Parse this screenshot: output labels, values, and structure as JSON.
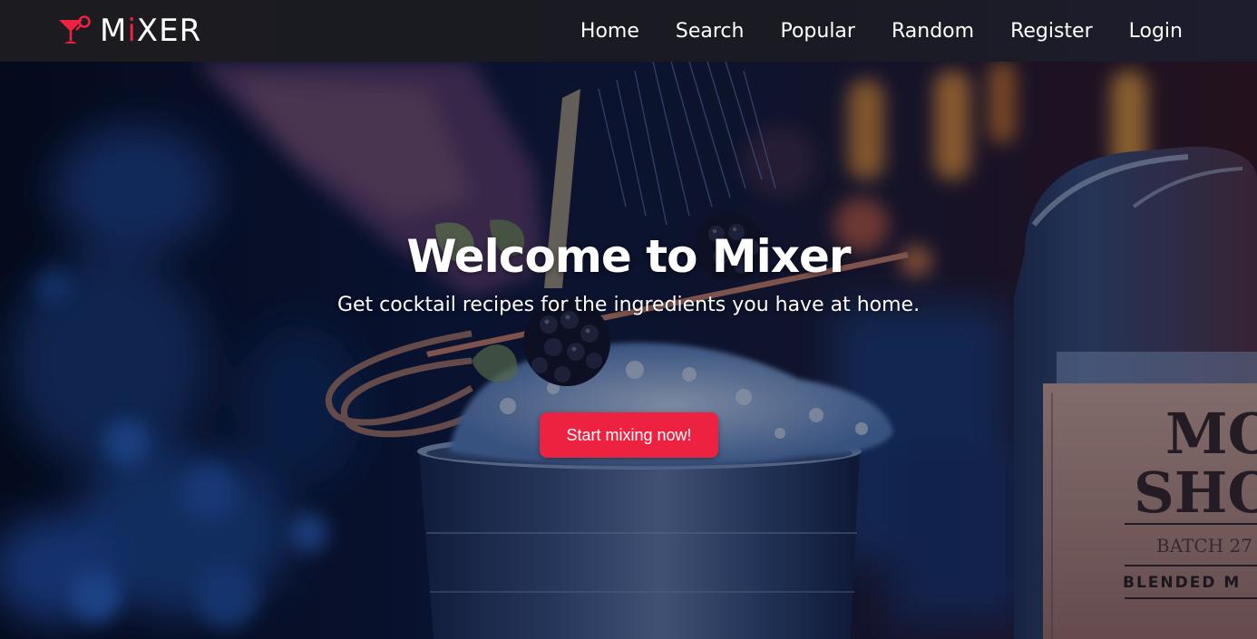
{
  "colors": {
    "accent": "#ed2240",
    "navbar_bg": "#1b1b20",
    "text": "#ffffff"
  },
  "brand": {
    "logo_icon": "cocktail-glass-icon",
    "name_prefix": "M",
    "name_accent": "i",
    "name_suffix": "XER"
  },
  "nav": {
    "items": [
      {
        "label": "Home"
      },
      {
        "label": "Search"
      },
      {
        "label": "Popular"
      },
      {
        "label": "Random"
      },
      {
        "label": "Register"
      },
      {
        "label": "Login"
      }
    ]
  },
  "hero": {
    "title": "Welcome to Mixer",
    "subtitle": "Get cocktail recipes for the ingredients you have at home.",
    "cta_label": "Start mixing now!",
    "bottle_label_line1": "MO",
    "bottle_label_line2": "SHO",
    "bottle_label_line3": "BATCH 27",
    "bottle_label_line4": "BLENDED M"
  }
}
